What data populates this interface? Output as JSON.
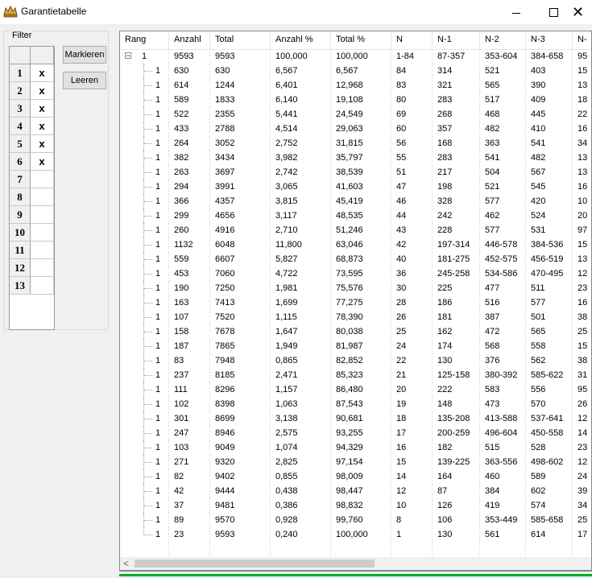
{
  "window": {
    "title": "Garantietabelle",
    "minimize_icon": "minimize-icon",
    "maximize_icon": "maximize-icon",
    "close_icon": "close-icon"
  },
  "filter": {
    "legend": "Filter",
    "markieren_label": "Markieren",
    "leeren_label": "Leeren",
    "rows": [
      {
        "num": "1",
        "val": "x"
      },
      {
        "num": "2",
        "val": "x"
      },
      {
        "num": "3",
        "val": "x"
      },
      {
        "num": "4",
        "val": "x"
      },
      {
        "num": "5",
        "val": "x"
      },
      {
        "num": "6",
        "val": "x"
      },
      {
        "num": "7",
        "val": ""
      },
      {
        "num": "8",
        "val": ""
      },
      {
        "num": "9",
        "val": ""
      },
      {
        "num": "10",
        "val": ""
      },
      {
        "num": "11",
        "val": ""
      },
      {
        "num": "12",
        "val": ""
      },
      {
        "num": "13",
        "val": ""
      }
    ]
  },
  "table": {
    "columns": [
      "Rang",
      "Anzahl",
      "Total",
      "Anzahl %",
      "Total %",
      "N",
      "N-1",
      "N-2",
      "N-3",
      "N-"
    ],
    "root": {
      "rang": "1",
      "anzahl": "9593",
      "total": "9593",
      "anzahl_pct": "100,000",
      "total_pct": "100,000",
      "n": "1-84",
      "n1": "87-357",
      "n2": "353-604",
      "n3": "384-658",
      "n4": "95"
    },
    "rows": [
      [
        "1",
        "630",
        "630",
        "6,567",
        "6,567",
        "84",
        "314",
        "521",
        "403",
        "15"
      ],
      [
        "1",
        "614",
        "1244",
        "6,401",
        "12,968",
        "83",
        "321",
        "565",
        "390",
        "13"
      ],
      [
        "1",
        "589",
        "1833",
        "6,140",
        "19,108",
        "80",
        "283",
        "517",
        "409",
        "18"
      ],
      [
        "1",
        "522",
        "2355",
        "5,441",
        "24,549",
        "69",
        "268",
        "468",
        "445",
        "22"
      ],
      [
        "1",
        "433",
        "2788",
        "4,514",
        "29,063",
        "60",
        "357",
        "482",
        "410",
        "16"
      ],
      [
        "1",
        "264",
        "3052",
        "2,752",
        "31,815",
        "56",
        "168",
        "363",
        "541",
        "34"
      ],
      [
        "1",
        "382",
        "3434",
        "3,982",
        "35,797",
        "55",
        "283",
        "541",
        "482",
        "13"
      ],
      [
        "1",
        "263",
        "3697",
        "2,742",
        "38,539",
        "51",
        "217",
        "504",
        "567",
        "13"
      ],
      [
        "1",
        "294",
        "3991",
        "3,065",
        "41,603",
        "47",
        "198",
        "521",
        "545",
        "16"
      ],
      [
        "1",
        "366",
        "4357",
        "3,815",
        "45,419",
        "46",
        "328",
        "577",
        "420",
        "10"
      ],
      [
        "1",
        "299",
        "4656",
        "3,117",
        "48,535",
        "44",
        "242",
        "462",
        "524",
        "20"
      ],
      [
        "1",
        "260",
        "4916",
        "2,710",
        "51,246",
        "43",
        "228",
        "577",
        "531",
        "97"
      ],
      [
        "1",
        "1132",
        "6048",
        "11,800",
        "63,046",
        "42",
        "197-314",
        "446-578",
        "384-536",
        "15"
      ],
      [
        "1",
        "559",
        "6607",
        "5,827",
        "68,873",
        "40",
        "181-275",
        "452-575",
        "456-519",
        "13"
      ],
      [
        "1",
        "453",
        "7060",
        "4,722",
        "73,595",
        "36",
        "245-258",
        "534-586",
        "470-495",
        "12"
      ],
      [
        "1",
        "190",
        "7250",
        "1,981",
        "75,576",
        "30",
        "225",
        "477",
        "511",
        "23"
      ],
      [
        "1",
        "163",
        "7413",
        "1,699",
        "77,275",
        "28",
        "186",
        "516",
        "577",
        "16"
      ],
      [
        "1",
        "107",
        "7520",
        "1,115",
        "78,390",
        "26",
        "181",
        "387",
        "501",
        "38"
      ],
      [
        "1",
        "158",
        "7678",
        "1,647",
        "80,038",
        "25",
        "162",
        "472",
        "565",
        "25"
      ],
      [
        "1",
        "187",
        "7865",
        "1,949",
        "81,987",
        "24",
        "174",
        "568",
        "558",
        "15"
      ],
      [
        "1",
        "83",
        "7948",
        "0,865",
        "82,852",
        "22",
        "130",
        "376",
        "562",
        "38"
      ],
      [
        "1",
        "237",
        "8185",
        "2,471",
        "85,323",
        "21",
        "125-158",
        "380-392",
        "585-622",
        "31"
      ],
      [
        "1",
        "111",
        "8296",
        "1,157",
        "86,480",
        "20",
        "222",
        "583",
        "556",
        "95"
      ],
      [
        "1",
        "102",
        "8398",
        "1,063",
        "87,543",
        "19",
        "148",
        "473",
        "570",
        "26"
      ],
      [
        "1",
        "301",
        "8699",
        "3,138",
        "90,681",
        "18",
        "135-208",
        "413-588",
        "537-641",
        "12"
      ],
      [
        "1",
        "247",
        "8946",
        "2,575",
        "93,255",
        "17",
        "200-259",
        "496-604",
        "450-558",
        "14"
      ],
      [
        "1",
        "103",
        "9049",
        "1,074",
        "94,329",
        "16",
        "182",
        "515",
        "528",
        "23"
      ],
      [
        "1",
        "271",
        "9320",
        "2,825",
        "97,154",
        "15",
        "139-225",
        "363-556",
        "498-602",
        "12"
      ],
      [
        "1",
        "82",
        "9402",
        "0,855",
        "98,009",
        "14",
        "164",
        "460",
        "589",
        "24"
      ],
      [
        "1",
        "42",
        "9444",
        "0,438",
        "98,447",
        "12",
        "87",
        "384",
        "602",
        "39"
      ],
      [
        "1",
        "37",
        "9481",
        "0,386",
        "98,832",
        "10",
        "126",
        "419",
        "574",
        "34"
      ],
      [
        "1",
        "89",
        "9570",
        "0,928",
        "99,760",
        "8",
        "106",
        "353-449",
        "585-658",
        "25"
      ],
      [
        "1",
        "23",
        "9593",
        "0,240",
        "100,000",
        "1",
        "130",
        "561",
        "614",
        "17"
      ]
    ]
  },
  "scrollbar": {
    "left_icon": "chevron-left-icon"
  }
}
